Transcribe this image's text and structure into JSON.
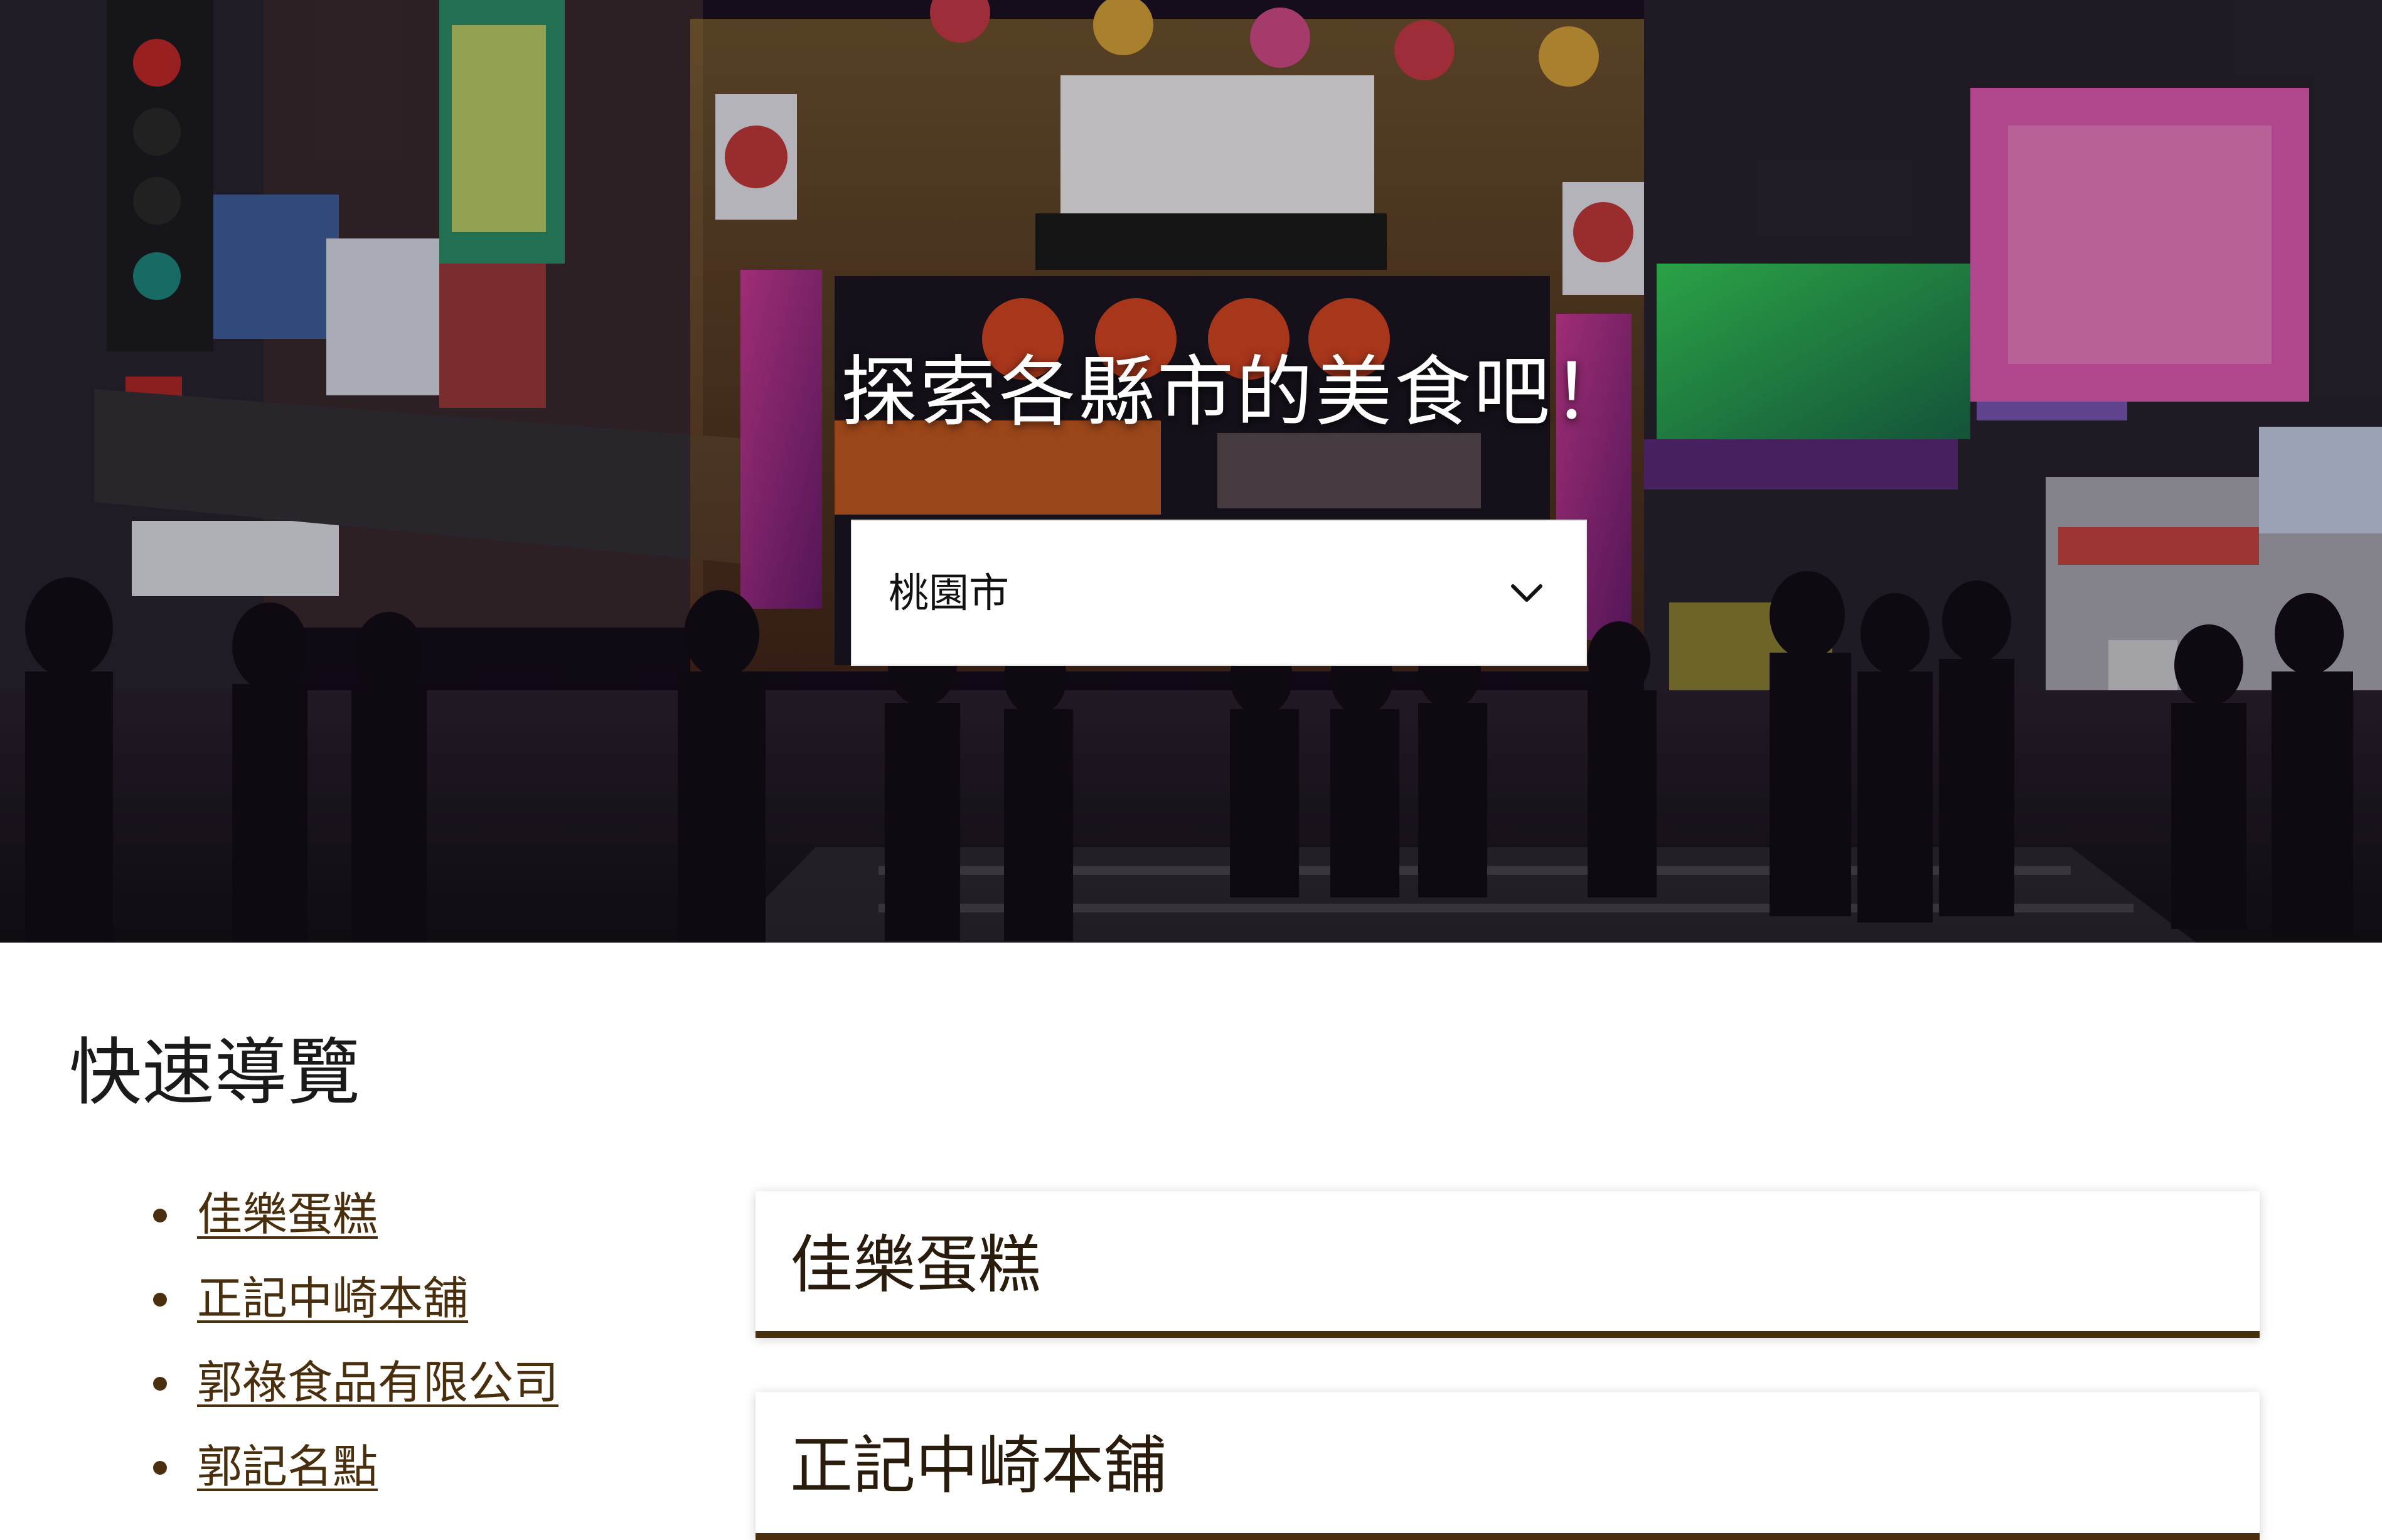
{
  "hero": {
    "heading": "探索各縣市的美食吧！",
    "photo_description_icon": "night-market-photo",
    "city_select": {
      "selected_value": "桃園市"
    }
  },
  "quick_nav": {
    "title": "快速導覽",
    "links": [
      "佳樂蛋糕",
      "正記中崎本舖",
      "郭祿食品有限公司",
      "郭記名點"
    ]
  },
  "cards": [
    {
      "title": "佳樂蛋糕"
    },
    {
      "title": "正記中崎本舖"
    }
  ],
  "colors": {
    "accent_brown": "#4a300f",
    "link_brown": "#4a2f0e",
    "hero_text": "#ffffff"
  }
}
